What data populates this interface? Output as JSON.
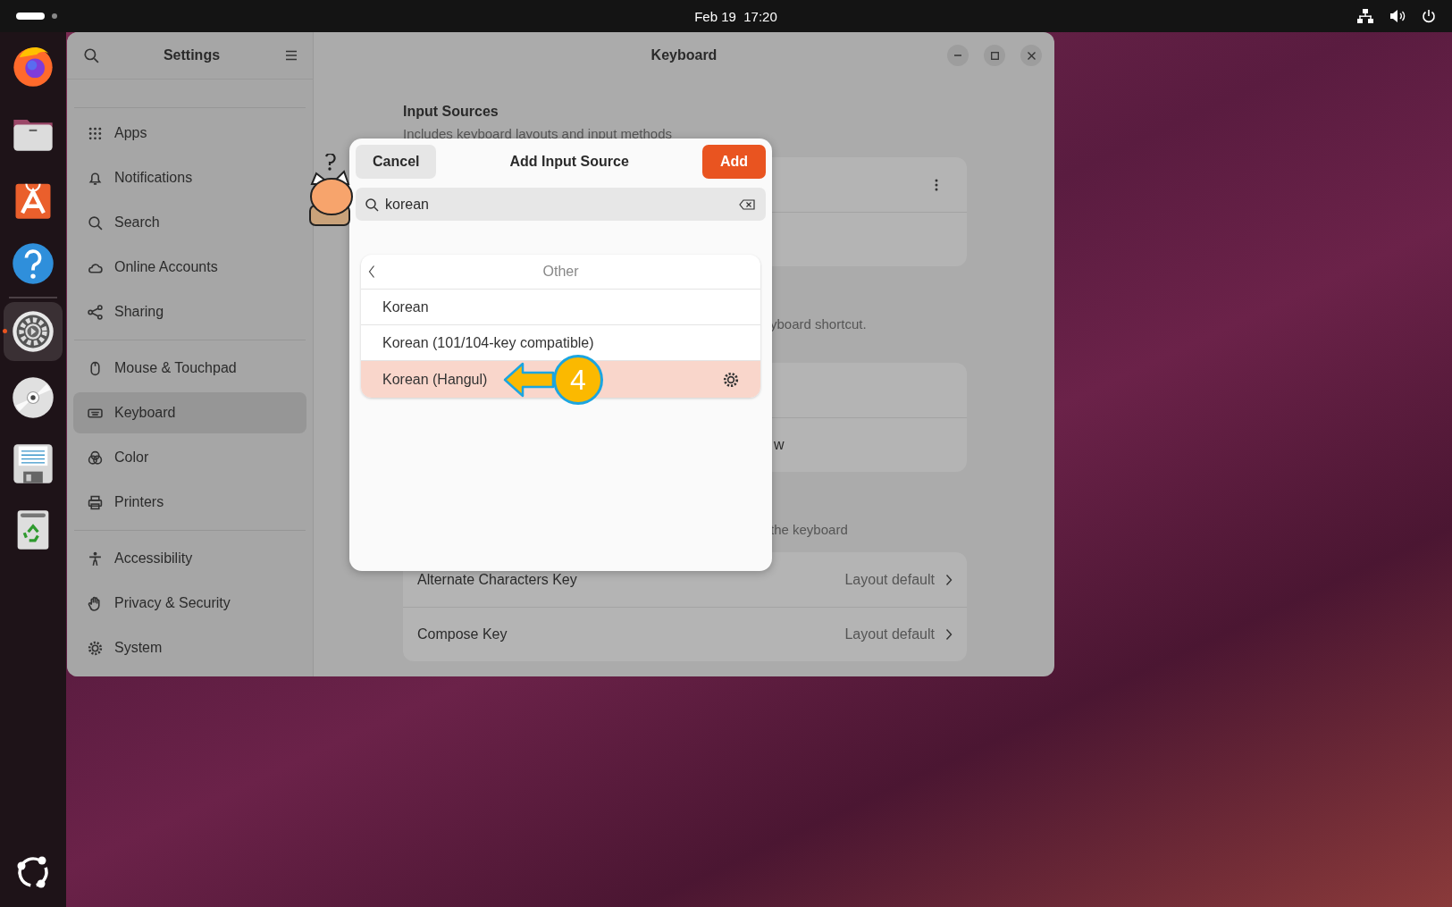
{
  "top_bar": {
    "clock": "Feb 19  17:20"
  },
  "dock": {
    "items": [
      {
        "kind": "firefox",
        "active": false
      },
      {
        "kind": "files",
        "active": false
      },
      {
        "kind": "store",
        "active": false
      },
      {
        "kind": "help",
        "active": false
      },
      {
        "kind": "settings",
        "active": true
      },
      {
        "kind": "disc",
        "active": false
      },
      {
        "kind": "save",
        "active": false
      },
      {
        "kind": "trash",
        "active": false
      }
    ]
  },
  "settings_window": {
    "sidebar": {
      "title": "Settings",
      "groups": [
        [
          {
            "label": "Apps",
            "selected": false
          },
          {
            "label": "Notifications",
            "selected": false
          },
          {
            "label": "Search",
            "selected": false
          },
          {
            "label": "Online Accounts",
            "selected": false
          },
          {
            "label": "Sharing",
            "selected": false
          }
        ],
        [
          {
            "label": "Mouse & Touchpad",
            "selected": false
          },
          {
            "label": "Keyboard",
            "selected": true
          },
          {
            "label": "Color",
            "selected": false
          },
          {
            "label": "Printers",
            "selected": false
          }
        ],
        [
          {
            "label": "Accessibility",
            "selected": false
          },
          {
            "label": "Privacy & Security",
            "selected": false
          },
          {
            "label": "System",
            "selected": false
          }
        ]
      ]
    },
    "content": {
      "title": "Keyboard",
      "input_sources": {
        "heading": "Input Sources",
        "description": "Includes keyboard layouts and input methods"
      },
      "switching_fragment": "yboard shortcut.",
      "switching_row_fragment": "w",
      "special_fragment": "the keyboard",
      "special_rows": [
        {
          "label": "Alternate Characters Key",
          "value": "Layout default"
        },
        {
          "label": "Compose Key",
          "value": "Layout default"
        }
      ]
    }
  },
  "dialog": {
    "title": "Add Input Source",
    "cancel": "Cancel",
    "add": "Add",
    "search": {
      "value": "korean"
    },
    "list_header": "Other",
    "rows": [
      {
        "label": "Korean",
        "selected": false,
        "settings": false
      },
      {
        "label": "Korean (101/104-key compatible)",
        "selected": false,
        "settings": false
      },
      {
        "label": "Korean (Hangul)",
        "selected": true,
        "settings": true
      }
    ]
  },
  "annotation": {
    "step": "4"
  }
}
